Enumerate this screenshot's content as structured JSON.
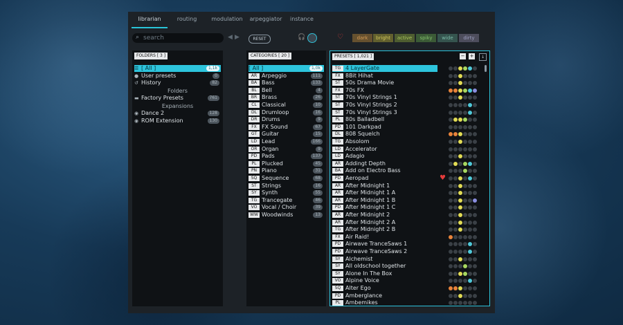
{
  "tabs": [
    "librarian",
    "routing",
    "modulation",
    "arpeggiator",
    "instance"
  ],
  "active_tab": 0,
  "search": {
    "placeholder": "search"
  },
  "reset_label": "RESET",
  "filters": [
    "dark",
    "bright",
    "active",
    "spiky",
    "wide",
    "dirty"
  ],
  "folders": {
    "header": "FOLDERS [ 3 ]",
    "items": [
      {
        "icon": "list-icon",
        "glyph": "☰",
        "label": "[ All ]",
        "count": "1,1k",
        "selected": true
      },
      {
        "icon": "user-icon",
        "glyph": "●",
        "label": "User presets",
        "count": "0"
      },
      {
        "icon": "history-icon",
        "glyph": "↺",
        "label": "History",
        "count": "82"
      }
    ],
    "folders_label": "Folders",
    "folder_items": [
      {
        "label": "Factory Presets",
        "count": "761"
      }
    ],
    "expansions_label": "Expansions",
    "expansion_items": [
      {
        "label": "Dance 2",
        "count": "128"
      },
      {
        "label": "ROM Extension",
        "count": "130"
      }
    ]
  },
  "categories": {
    "header": "CATEGORIES [ 20 ]",
    "items": [
      {
        "tag": "",
        "label": "[ All ]",
        "count": "1,0k",
        "selected": true
      },
      {
        "tag": "AR",
        "label": "Arpeggio",
        "count": "111"
      },
      {
        "tag": "BA",
        "label": "Bass",
        "count": "133"
      },
      {
        "tag": "BL",
        "label": "Bell",
        "count": "4"
      },
      {
        "tag": "BR",
        "label": "Brass",
        "count": "26"
      },
      {
        "tag": "CL",
        "label": "Classical",
        "count": "10"
      },
      {
        "tag": "DL",
        "label": "Drumloop",
        "count": "16"
      },
      {
        "tag": "DR",
        "label": "Drums",
        "count": "9"
      },
      {
        "tag": "FX",
        "label": "FX Sound",
        "count": "67"
      },
      {
        "tag": "GT",
        "label": "Guitar",
        "count": "15"
      },
      {
        "tag": "LD",
        "label": "Lead",
        "count": "166"
      },
      {
        "tag": "OR",
        "label": "Organ",
        "count": "9"
      },
      {
        "tag": "PD",
        "label": "Pads",
        "count": "137"
      },
      {
        "tag": "PL",
        "label": "Plucked",
        "count": "45"
      },
      {
        "tag": "PN",
        "label": "Piano",
        "count": "31"
      },
      {
        "tag": "SQ",
        "label": "Sequence",
        "count": "68"
      },
      {
        "tag": "ST",
        "label": "Strings",
        "count": "16"
      },
      {
        "tag": "SY",
        "label": "Synth",
        "count": "55"
      },
      {
        "tag": "TG",
        "label": "Trancegate",
        "count": "46"
      },
      {
        "tag": "VO",
        "label": "Vocal / Choir",
        "count": "39"
      },
      {
        "tag": "WW",
        "label": "Woodwinds",
        "count": "13"
      }
    ]
  },
  "presets": {
    "header": "PRESETS [ 1,021 ]",
    "minus_label": "−",
    "plus_label": "+",
    "sort_glyph": "↓",
    "dot_colors": {
      "off": "#3a4046",
      "or": "#e8833a",
      "ye": "#e2dc55",
      "lg": "#a8d860",
      "gr": "#6cc878",
      "tq": "#4fc9d9",
      "pu": "#8a8ee0"
    },
    "items": [
      {
        "tag": "TG",
        "label": "4 LayerGate",
        "selected": true,
        "dots": [
          "off",
          "off",
          "ye",
          "lg",
          "tq",
          "off"
        ]
      },
      {
        "tag": "FX",
        "label": "8Bit Hihat",
        "dots": [
          "off",
          "off",
          "ye",
          "off",
          "off",
          "off"
        ]
      },
      {
        "tag": "ST",
        "label": "50s Drama Movie",
        "dots": [
          "off",
          "off",
          "ye",
          "off",
          "off",
          "off"
        ]
      },
      {
        "tag": "FX",
        "label": "70s FX",
        "dots": [
          "or",
          "or",
          "ye",
          "lg",
          "tq",
          "pu"
        ]
      },
      {
        "tag": "ST",
        "label": "70s Vinyl Strings 1",
        "dots": [
          "off",
          "off",
          "ye",
          "off",
          "off",
          "off"
        ]
      },
      {
        "tag": "ST",
        "label": "70s Vinyl Strings 2",
        "dots": [
          "off",
          "off",
          "off",
          "off",
          "tq",
          "off"
        ]
      },
      {
        "tag": "ST",
        "label": "70s Vinyl Strings 3",
        "dots": [
          "off",
          "off",
          "off",
          "off",
          "tq",
          "off"
        ]
      },
      {
        "tag": "PL",
        "label": "80s Balladbell",
        "dots": [
          "off",
          "ye",
          "ye",
          "lg",
          "off",
          "off"
        ]
      },
      {
        "tag": "PD",
        "label": "101 Darkpad",
        "dots": [
          "off",
          "off",
          "off",
          "off",
          "off",
          "off"
        ]
      },
      {
        "tag": "DL",
        "label": "808 Squelch",
        "dots": [
          "or",
          "or",
          "ye",
          "off",
          "off",
          "off"
        ]
      },
      {
        "tag": "TG",
        "label": "Absolom",
        "dots": [
          "off",
          "off",
          "ye",
          "off",
          "off",
          "off"
        ]
      },
      {
        "tag": "LD",
        "label": "Accelerator",
        "dots": [
          "off",
          "off",
          "off",
          "off",
          "off",
          "off"
        ]
      },
      {
        "tag": "LD",
        "label": "Adagio",
        "dots": [
          "off",
          "off",
          "ye",
          "off",
          "off",
          "off"
        ]
      },
      {
        "tag": "AR",
        "label": "Addingt Depth",
        "dots": [
          "off",
          "ye",
          "off",
          "lg",
          "tq",
          "off"
        ]
      },
      {
        "tag": "BA",
        "label": "Add on Electro Bass",
        "dots": [
          "off",
          "off",
          "off",
          "lg",
          "off",
          "off"
        ]
      },
      {
        "tag": "PD",
        "label": "Aeropad",
        "heart": true,
        "dots": [
          "off",
          "off",
          "ye",
          "off",
          "tq",
          "off"
        ]
      },
      {
        "tag": "AR",
        "label": "After Midnight 1",
        "dots": [
          "off",
          "off",
          "ye",
          "off",
          "off",
          "off"
        ]
      },
      {
        "tag": "AR",
        "label": "After Midnight 1 A",
        "dots": [
          "off",
          "off",
          "ye",
          "off",
          "off",
          "off"
        ]
      },
      {
        "tag": "AR",
        "label": "After Midnight 1 B",
        "dots": [
          "off",
          "off",
          "ye",
          "off",
          "off",
          "pu"
        ]
      },
      {
        "tag": "PD",
        "label": "After Midnight 1 C",
        "dots": [
          "off",
          "off",
          "ye",
          "off",
          "off",
          "off"
        ]
      },
      {
        "tag": "AR",
        "label": "After Midnight 2",
        "dots": [
          "off",
          "off",
          "ye",
          "off",
          "off",
          "off"
        ]
      },
      {
        "tag": "AR",
        "label": "After Midnight 2 A",
        "dots": [
          "off",
          "off",
          "ye",
          "off",
          "off",
          "off"
        ]
      },
      {
        "tag": "TG",
        "label": "After Midnight 2 B",
        "dots": [
          "off",
          "off",
          "ye",
          "off",
          "off",
          "off"
        ]
      },
      {
        "tag": "FX",
        "label": "Air Raid!",
        "dots": [
          "or",
          "off",
          "off",
          "off",
          "off",
          "off"
        ]
      },
      {
        "tag": "PD",
        "label": "Airwave TranceSaws 1",
        "dots": [
          "off",
          "off",
          "off",
          "off",
          "tq",
          "off"
        ]
      },
      {
        "tag": "PD",
        "label": "Airwave TranceSaws 2",
        "dots": [
          "off",
          "off",
          "off",
          "off",
          "tq",
          "off"
        ]
      },
      {
        "tag": "SY",
        "label": "Alchemist",
        "dots": [
          "off",
          "off",
          "ye",
          "off",
          "off",
          "off"
        ]
      },
      {
        "tag": "SY",
        "label": "All oldschool together",
        "dots": [
          "off",
          "off",
          "off",
          "lg",
          "off",
          "off"
        ]
      },
      {
        "tag": "SY",
        "label": "Alone In The Box",
        "dots": [
          "off",
          "off",
          "ye",
          "lg",
          "off",
          "off"
        ]
      },
      {
        "tag": "VO",
        "label": "Alpine Voice",
        "dots": [
          "off",
          "off",
          "off",
          "off",
          "tq",
          "off"
        ]
      },
      {
        "tag": "SQ",
        "label": "Alter Ego",
        "dots": [
          "or",
          "or",
          "ye",
          "off",
          "off",
          "off"
        ]
      },
      {
        "tag": "PD",
        "label": "Amberglance",
        "dots": [
          "off",
          "off",
          "ye",
          "off",
          "off",
          "off"
        ]
      },
      {
        "tag": "PL",
        "label": "Ambemikes",
        "dots": [
          "off",
          "off",
          "off",
          "off",
          "off",
          "off"
        ]
      }
    ]
  }
}
